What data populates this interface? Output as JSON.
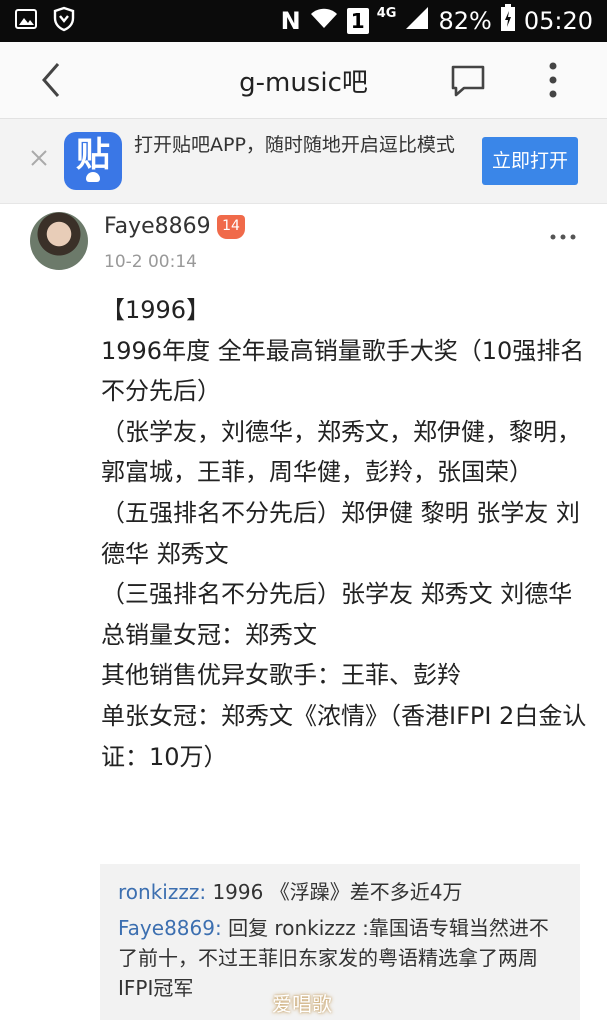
{
  "status_bar": {
    "battery_percent": "82%",
    "time": "05:20",
    "network_label": "4G",
    "carrier_letter": "N",
    "sim_number": "1",
    "icons": [
      "gallery-icon",
      "shield-icon",
      "nfc-icon",
      "wifi-icon",
      "sim-icon",
      "signal-icon",
      "battery-icon"
    ]
  },
  "nav": {
    "title": "g-music吧",
    "icons": [
      "back-icon",
      "chat-icon",
      "more-vertical-icon"
    ]
  },
  "banner": {
    "app_icon_glyph": "贴",
    "text": "打开贴吧APP，随时随地开启逗比模式",
    "button_label": "立即打开"
  },
  "post": {
    "author": "Faye8869",
    "level": "14",
    "time": "10-2 00:14",
    "paragraphs": [
      "【1996】",
      "1996年度 全年最高销量歌手大奖（10强排名不分先后）",
      "（张学友，刘德华，郑秀文，郑伊健，黎明，郭富城，王菲，周华健，彭羚，张国荣）",
      "（五强排名不分先后）郑伊健 黎明 张学友 刘德华 郑秀文",
      "（三强排名不分先后）张学友 郑秀文 刘德华",
      "总销量女冠：郑秀文",
      "其他销售优异女歌手：王菲、彭羚",
      "单张女冠：郑秀文《浓情》（香港IFPI 2白金认证：10万）"
    ]
  },
  "comments": [
    {
      "author": "ronkizzz",
      "sep": ": ",
      "text": "1996 《浮躁》差不多近4万"
    },
    {
      "author": "Faye8869",
      "sep": ": ",
      "text": "回复 ronkizzz :靠国语专辑当然进不了前十，不过王菲旧东家发的粤语精选拿了两周IFPI冠军"
    }
  ],
  "watermark": "爱唱歌",
  "colors": {
    "accent_blue": "#3a86e8",
    "author_blue": "#3c6fb0",
    "badge_orange": "#f06a4a",
    "status_bar": "#0b0b0b"
  }
}
